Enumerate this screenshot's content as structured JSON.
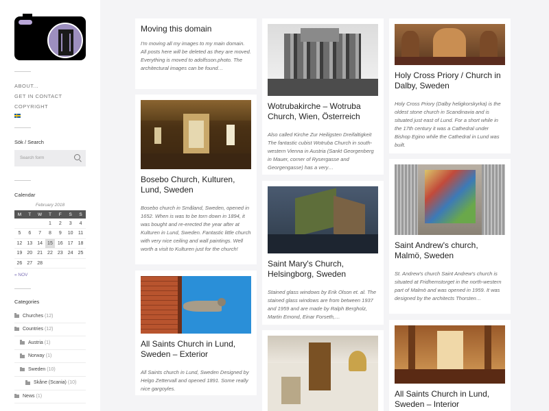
{
  "menu": [
    "ABOUT...",
    "GET IN CONTACT",
    "COPYRIGHT"
  ],
  "search": {
    "title": "Sök / Search",
    "placeholder": "Search form"
  },
  "calendar": {
    "title": "Calendar",
    "caption": "February 2018",
    "weekdays": [
      "M",
      "T",
      "W",
      "T",
      "F",
      "S",
      "S"
    ],
    "weeks": [
      [
        "",
        "",
        "",
        "1",
        "2",
        "3",
        "4"
      ],
      [
        "5",
        "6",
        "7",
        "8",
        "9",
        "10",
        "11"
      ],
      [
        "12",
        "13",
        "14",
        "15",
        "16",
        "17",
        "18"
      ],
      [
        "19",
        "20",
        "21",
        "22",
        "23",
        "24",
        "25"
      ],
      [
        "26",
        "27",
        "28",
        "",
        "",
        "",
        ""
      ]
    ],
    "today": "15",
    "prev": "« NOV"
  },
  "categories": {
    "title": "Categories",
    "items": [
      {
        "name": "Churches",
        "count": "(12)",
        "level": 0
      },
      {
        "name": "Countries",
        "count": "(12)",
        "level": 0
      },
      {
        "name": "Austria",
        "count": "(1)",
        "level": 1
      },
      {
        "name": "Norway",
        "count": "(1)",
        "level": 1
      },
      {
        "name": "Sweden",
        "count": "(10)",
        "level": 1
      },
      {
        "name": "Skåne (Scania)",
        "count": "(10)",
        "level": 2
      },
      {
        "name": "News",
        "count": "(1)",
        "level": 0
      }
    ]
  },
  "posts": [
    {
      "title": "Moving this domain",
      "excerpt": "I'm moving all my images to my main domain. All posts here will be deleted as they are moved. Everything is moved to adolfsson.photo. The architectural images can be found…"
    },
    {
      "title": "Bosebo Church, Kulturen, Lund, Sweden",
      "excerpt": "Bosebo church in Småland, Sweden, opened in 1652. When is was to be torn down in 1894, it was bought and re-erected the year after at Kulturen in Lund, Sweden. Fantastic little church with very nice ceiling and wall paintings. Well worth a visit to Kulturen just for the church!"
    },
    {
      "title": "All Saints Church in Lund, Sweden – Exterior",
      "excerpt": "All Saints church in Lund, Sweden Designed by Helgo Zettervall and opened 1891. Some really nice gargoyles."
    },
    {
      "title": "Wotrubakirche – Wotruba Church, Wien, Österreich",
      "excerpt": "Also called Kirche Zur Heiligsten Dreifaltigkeit The fantastic cubist Wotruba Church in south-western Vienna in Austria (Sankt Georgenberg in Mauer, corner of Rysergasse and Georgengasse) has a very…"
    },
    {
      "title": "Saint Mary's Church, Helsingborg, Sweden",
      "excerpt": "Stained glass windows by Erik Olson et. al. The stained glass windows are from between 1937 and 1959 and are made by Ralph Bergholz, Martin Emond, Einar Forseth,…"
    },
    {
      "title": "Holy Cross Priory / Church in Dalby, Sweden",
      "excerpt": "Holy Cross Priory (Dalby heligkorskyrka) is the oldest stone church in Scandinavia and is situated just east of Lund. For a short while in the 17th century it was a Cathedral under Bishop Egino while the Cathedral in Lund was built."
    },
    {
      "title": "Saint Andrew's church, Malmö, Sweden",
      "excerpt": "St. Andrew's church Saint Andrew's church is situated at Fridhemstorget in the north-western part of Malmö and was opened in 1959. It was designed by the architects Thorsten…"
    },
    {
      "title": "All Saints Church in Lund, Sweden – Interior",
      "excerpt": ""
    }
  ]
}
